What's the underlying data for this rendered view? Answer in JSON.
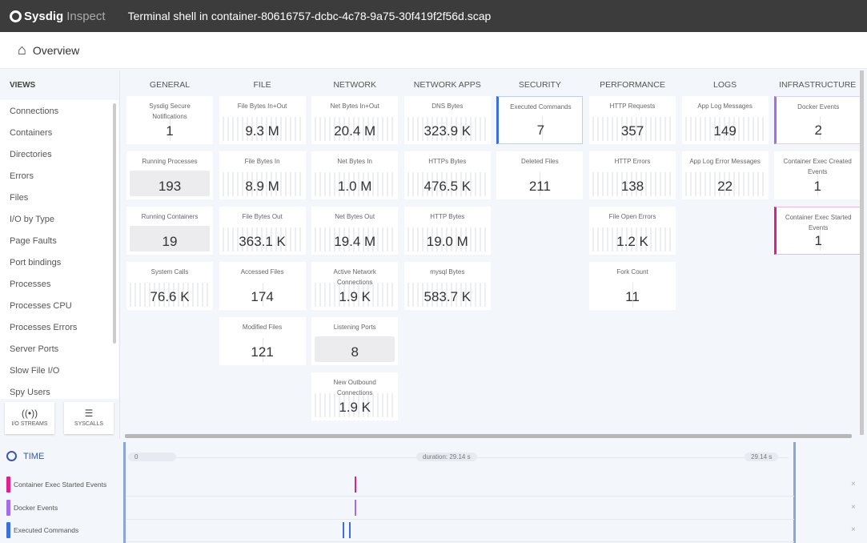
{
  "app": {
    "brand": "Sysdig",
    "product": "Inspect",
    "file_title": "Terminal shell in container-80616757-dcbc-4c78-9a75-30f419f2f56d.scap"
  },
  "breadcrumb": {
    "label": "Overview",
    "icon": "home-icon"
  },
  "sidebar": {
    "header": "VIEWS",
    "items": [
      "Connections",
      "Containers",
      "Directories",
      "Errors",
      "Files",
      "I/O by Type",
      "Page Faults",
      "Port bindings",
      "Processes",
      "Processes CPU",
      "Processes Errors",
      "Server Ports",
      "Slow File I/O",
      "Spy Users"
    ],
    "buttons": [
      {
        "label": "I/O STREAMS",
        "icon": "io-streams-icon"
      },
      {
        "label": "SYSCALLS",
        "icon": "syscalls-icon"
      }
    ]
  },
  "colors": {
    "executed": "#3b6fe0",
    "docker": "#a36ee6",
    "container_exec": "#e0208a"
  },
  "columns": [
    {
      "header": "GENERAL",
      "cards": [
        {
          "title": "Sysdig Secure Notifications",
          "value": "1",
          "spark": "none"
        },
        {
          "title": "Running Processes",
          "value": "193",
          "spark": "flat"
        },
        {
          "title": "Running Containers",
          "value": "19",
          "spark": "flat"
        },
        {
          "title": "System Calls",
          "value": "76.6 K",
          "spark": "bars"
        }
      ]
    },
    {
      "header": "FILE",
      "cards": [
        {
          "title": "File Bytes In+Out",
          "value": "9.3 M",
          "spark": "bars"
        },
        {
          "title": "File Bytes In",
          "value": "8.9 M",
          "spark": "bars"
        },
        {
          "title": "File Bytes Out",
          "value": "363.1 K",
          "spark": "bars"
        },
        {
          "title": "Accessed Files",
          "value": "174",
          "spark": "none"
        },
        {
          "title": "Modified Files",
          "value": "121",
          "spark": "none"
        }
      ]
    },
    {
      "header": "NETWORK",
      "cards": [
        {
          "title": "Net Bytes In+Out",
          "value": "20.4 M",
          "spark": "bars"
        },
        {
          "title": "Net Bytes In",
          "value": "1.0 M",
          "spark": "bars"
        },
        {
          "title": "Net Bytes Out",
          "value": "19.4 M",
          "spark": "bars"
        },
        {
          "title": "Active Network Connections",
          "value": "1.9 K",
          "spark": "bars"
        },
        {
          "title": "Listening Ports",
          "value": "8",
          "spark": "flat"
        },
        {
          "title": "New Outbound Connections",
          "value": "1.9 K",
          "spark": "bars"
        }
      ]
    },
    {
      "header": "NETWORK APPS",
      "cards": [
        {
          "title": "DNS Bytes",
          "value": "323.9 K",
          "spark": "bars"
        },
        {
          "title": "HTTPs Bytes",
          "value": "476.5 K",
          "spark": "bars"
        },
        {
          "title": "HTTP Bytes",
          "value": "19.0 M",
          "spark": "bars"
        },
        {
          "title": "mysql Bytes",
          "value": "583.7 K",
          "spark": "bars"
        }
      ]
    },
    {
      "header": "SECURITY",
      "cards": [
        {
          "title": "Executed Commands",
          "value": "7",
          "spark": "none",
          "highlight": "executed"
        },
        {
          "title": "Deleted Files",
          "value": "211",
          "spark": "none"
        }
      ]
    },
    {
      "header": "PERFORMANCE",
      "cards": [
        {
          "title": "HTTP Requests",
          "value": "357",
          "spark": "bars"
        },
        {
          "title": "HTTP Errors",
          "value": "138",
          "spark": "bars"
        },
        {
          "title": "File Open Errors",
          "value": "1.2 K",
          "spark": "bars"
        },
        {
          "title": "Fork Count",
          "value": "11",
          "spark": "none"
        }
      ]
    },
    {
      "header": "LOGS",
      "cards": [
        {
          "title": "App Log Messages",
          "value": "149",
          "spark": "bars"
        },
        {
          "title": "App Log Error Messages",
          "value": "22",
          "spark": "bars"
        }
      ]
    },
    {
      "header": "INFRASTRUCTURE",
      "cards": [
        {
          "title": "Docker Events",
          "value": "2",
          "spark": "none",
          "highlight": "docker"
        },
        {
          "title": "Container Exec Created Events",
          "value": "1",
          "spark": "none"
        },
        {
          "title": "Container Exec Started Events",
          "value": "1",
          "spark": "none",
          "highlight": "container_exec"
        }
      ]
    }
  ],
  "time": {
    "header": "TIME",
    "start": "0",
    "duration": "duration: 29.14 s",
    "end": "29.14 s",
    "rows": [
      {
        "label": "Container Exec Started Events",
        "color": "container_exec"
      },
      {
        "label": "Docker Events",
        "color": "docker"
      },
      {
        "label": "Executed Commands",
        "color": "executed"
      }
    ],
    "remove_icon": "close-icon"
  }
}
